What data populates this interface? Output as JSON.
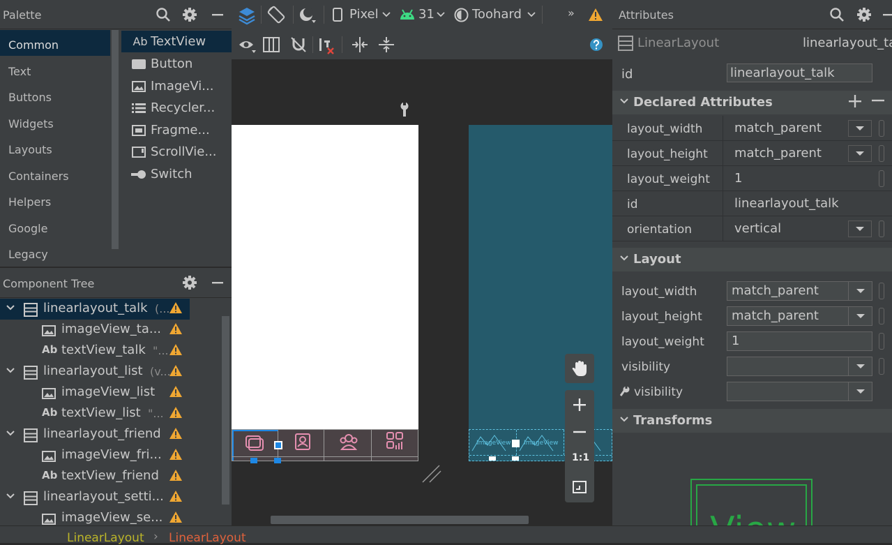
{
  "palette": {
    "title": "Palette",
    "categories": [
      "Common",
      "Text",
      "Buttons",
      "Widgets",
      "Layouts",
      "Containers",
      "Helpers",
      "Google",
      "Legacy"
    ],
    "items": [
      "TextView",
      "Button",
      "ImageVi...",
      "Recycler...",
      "Fragme...",
      "ScrollVie...",
      "Switch"
    ],
    "textview_prefix": "Ab"
  },
  "tree": {
    "title": "Component Tree",
    "rows": [
      {
        "label": "linearlayout_talk",
        "suffix": "(...",
        "type": "layout",
        "depth": 0
      },
      {
        "label": "imageView_ta...",
        "suffix": "",
        "type": "image",
        "depth": 1
      },
      {
        "label": "textView_talk",
        "suffix": "\"...",
        "type": "text",
        "depth": 1
      },
      {
        "label": "linearlayout_list",
        "suffix": "(v...",
        "type": "layout",
        "depth": 0
      },
      {
        "label": "imageView_list",
        "suffix": "",
        "type": "image",
        "depth": 1
      },
      {
        "label": "textView_list",
        "suffix": "\"...",
        "type": "text",
        "depth": 1
      },
      {
        "label": "linearlayout_friend",
        "suffix": "",
        "type": "layout",
        "depth": 0
      },
      {
        "label": "imageView_fri...",
        "suffix": "",
        "type": "image",
        "depth": 1
      },
      {
        "label": "textView_friend",
        "suffix": "",
        "type": "text",
        "depth": 1
      },
      {
        "label": "linearlayout_setti...",
        "suffix": "",
        "type": "layout",
        "depth": 0
      },
      {
        "label": "imageView_se...",
        "suffix": "",
        "type": "image",
        "depth": 1
      }
    ],
    "ab_prefix": "Ab"
  },
  "toolbar": {
    "device": "Pixel",
    "api": "31",
    "theme": "Toohard",
    "more": "»"
  },
  "canvas": {
    "zoom_fit_label": "1:1",
    "blueprint_label": "ImageView"
  },
  "attributes": {
    "title": "Attributes",
    "component_type": "LinearLayout",
    "component_id": "linearlayout_talk",
    "id_label": "id",
    "id_value": "linearlayout_talk",
    "declared": {
      "title": "Declared Attributes",
      "rows": [
        {
          "key": "layout_width",
          "value": "match_parent"
        },
        {
          "key": "layout_height",
          "value": "match_parent"
        },
        {
          "key": "layout_weight",
          "value": "1"
        },
        {
          "key": "id",
          "value": "linearlayout_talk"
        },
        {
          "key": "orientation",
          "value": "vertical"
        }
      ]
    },
    "layout": {
      "title": "Layout",
      "rows": [
        {
          "key": "layout_width",
          "value": "match_parent"
        },
        {
          "key": "layout_height",
          "value": "match_parent"
        },
        {
          "key": "layout_weight",
          "value": "1"
        },
        {
          "key": "visibility",
          "value": ""
        },
        {
          "key": "visibility",
          "value": ""
        }
      ]
    },
    "transforms": {
      "title": "Transforms"
    },
    "preview_text": "View"
  },
  "status": {
    "crumbs": [
      "LinearLayout",
      "LinearLayout"
    ],
    "sep": "›"
  },
  "colors": {
    "selection": "#0d293e",
    "warning": "#f0a732",
    "teal_screen": "#255a6b",
    "pink_icons": "#e58fb0",
    "blueprint": "#5ec2e0",
    "crumb_left": "#bbb529",
    "crumb_right": "#e0623c",
    "preview_green": "#28a745"
  }
}
